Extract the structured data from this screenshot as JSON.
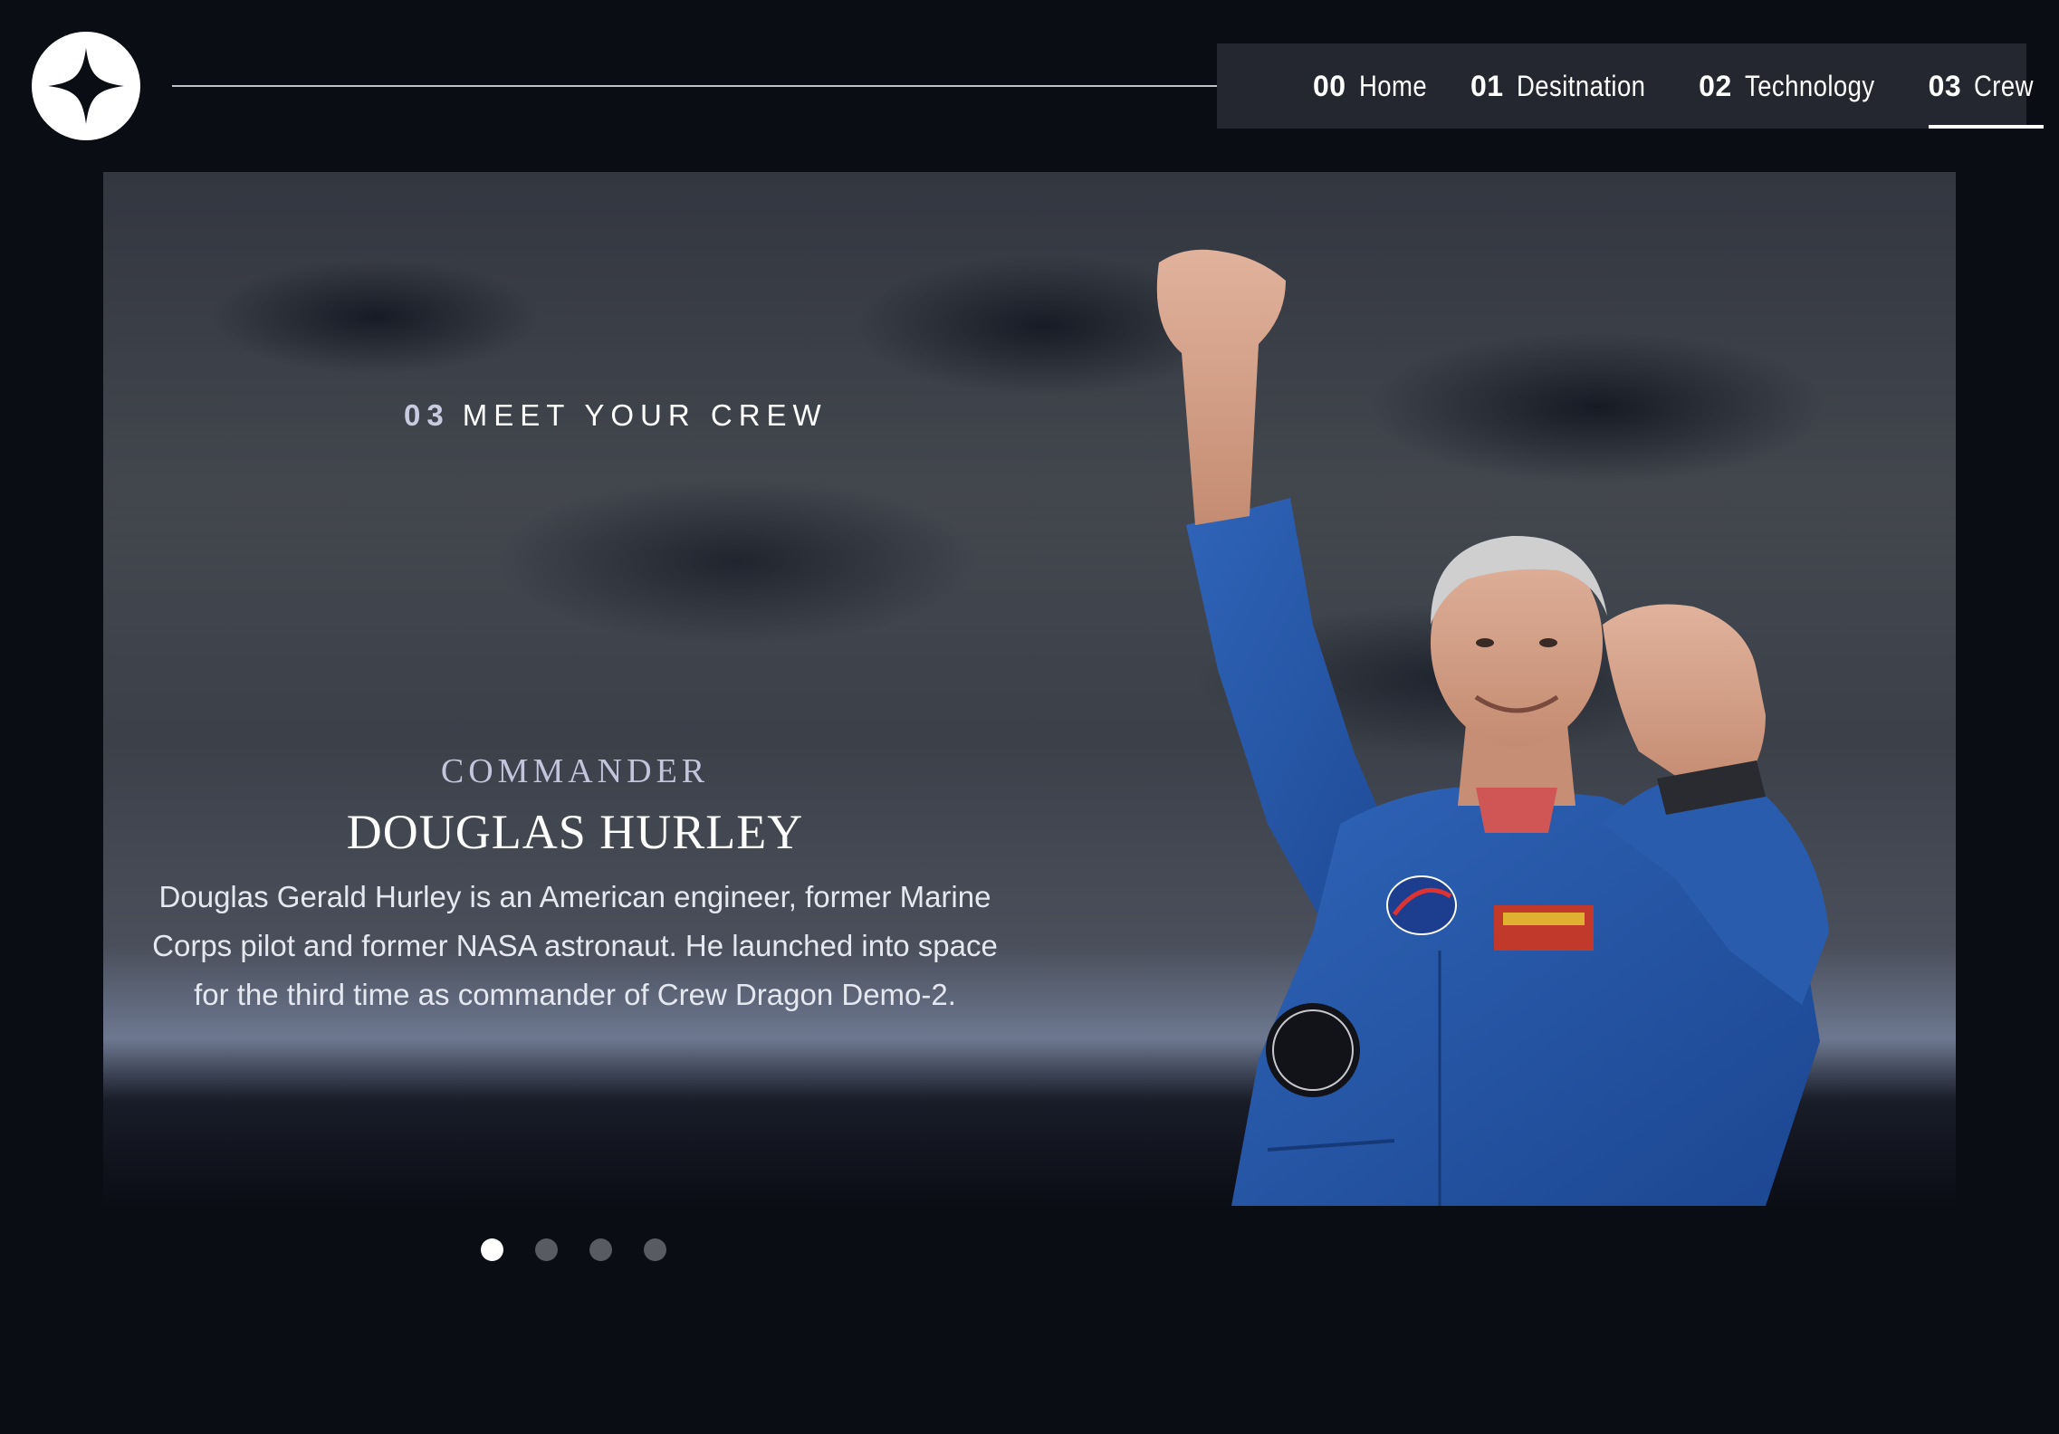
{
  "header": {
    "logo_icon": "star-icon",
    "nav": [
      {
        "num": "00",
        "label": "Home",
        "active": false
      },
      {
        "num": "01",
        "label": "Desitnation",
        "active": false
      },
      {
        "num": "02",
        "label": "Technology",
        "active": false
      },
      {
        "num": "03",
        "label": "Crew",
        "active": true
      }
    ]
  },
  "page": {
    "section_num": "03",
    "section_title": "MEET YOUR CREW"
  },
  "crew": {
    "role": "COMMANDER",
    "name": "DOUGLAS HURLEY",
    "bio": "Douglas Gerald Hurley is an American engineer, former Marine Corps pilot and former NASA astronaut. He launched into space for the third time as commander of Crew Dragon Demo-2.",
    "image": "astronaut-photo",
    "slides": {
      "count": 4,
      "active_index": 0
    }
  },
  "colors": {
    "background": "#0b0d15",
    "nav_background": "#24272f",
    "role_text": "#c3c5dc",
    "dot_inactive": "#595b63",
    "dot_active": "#ffffff"
  }
}
